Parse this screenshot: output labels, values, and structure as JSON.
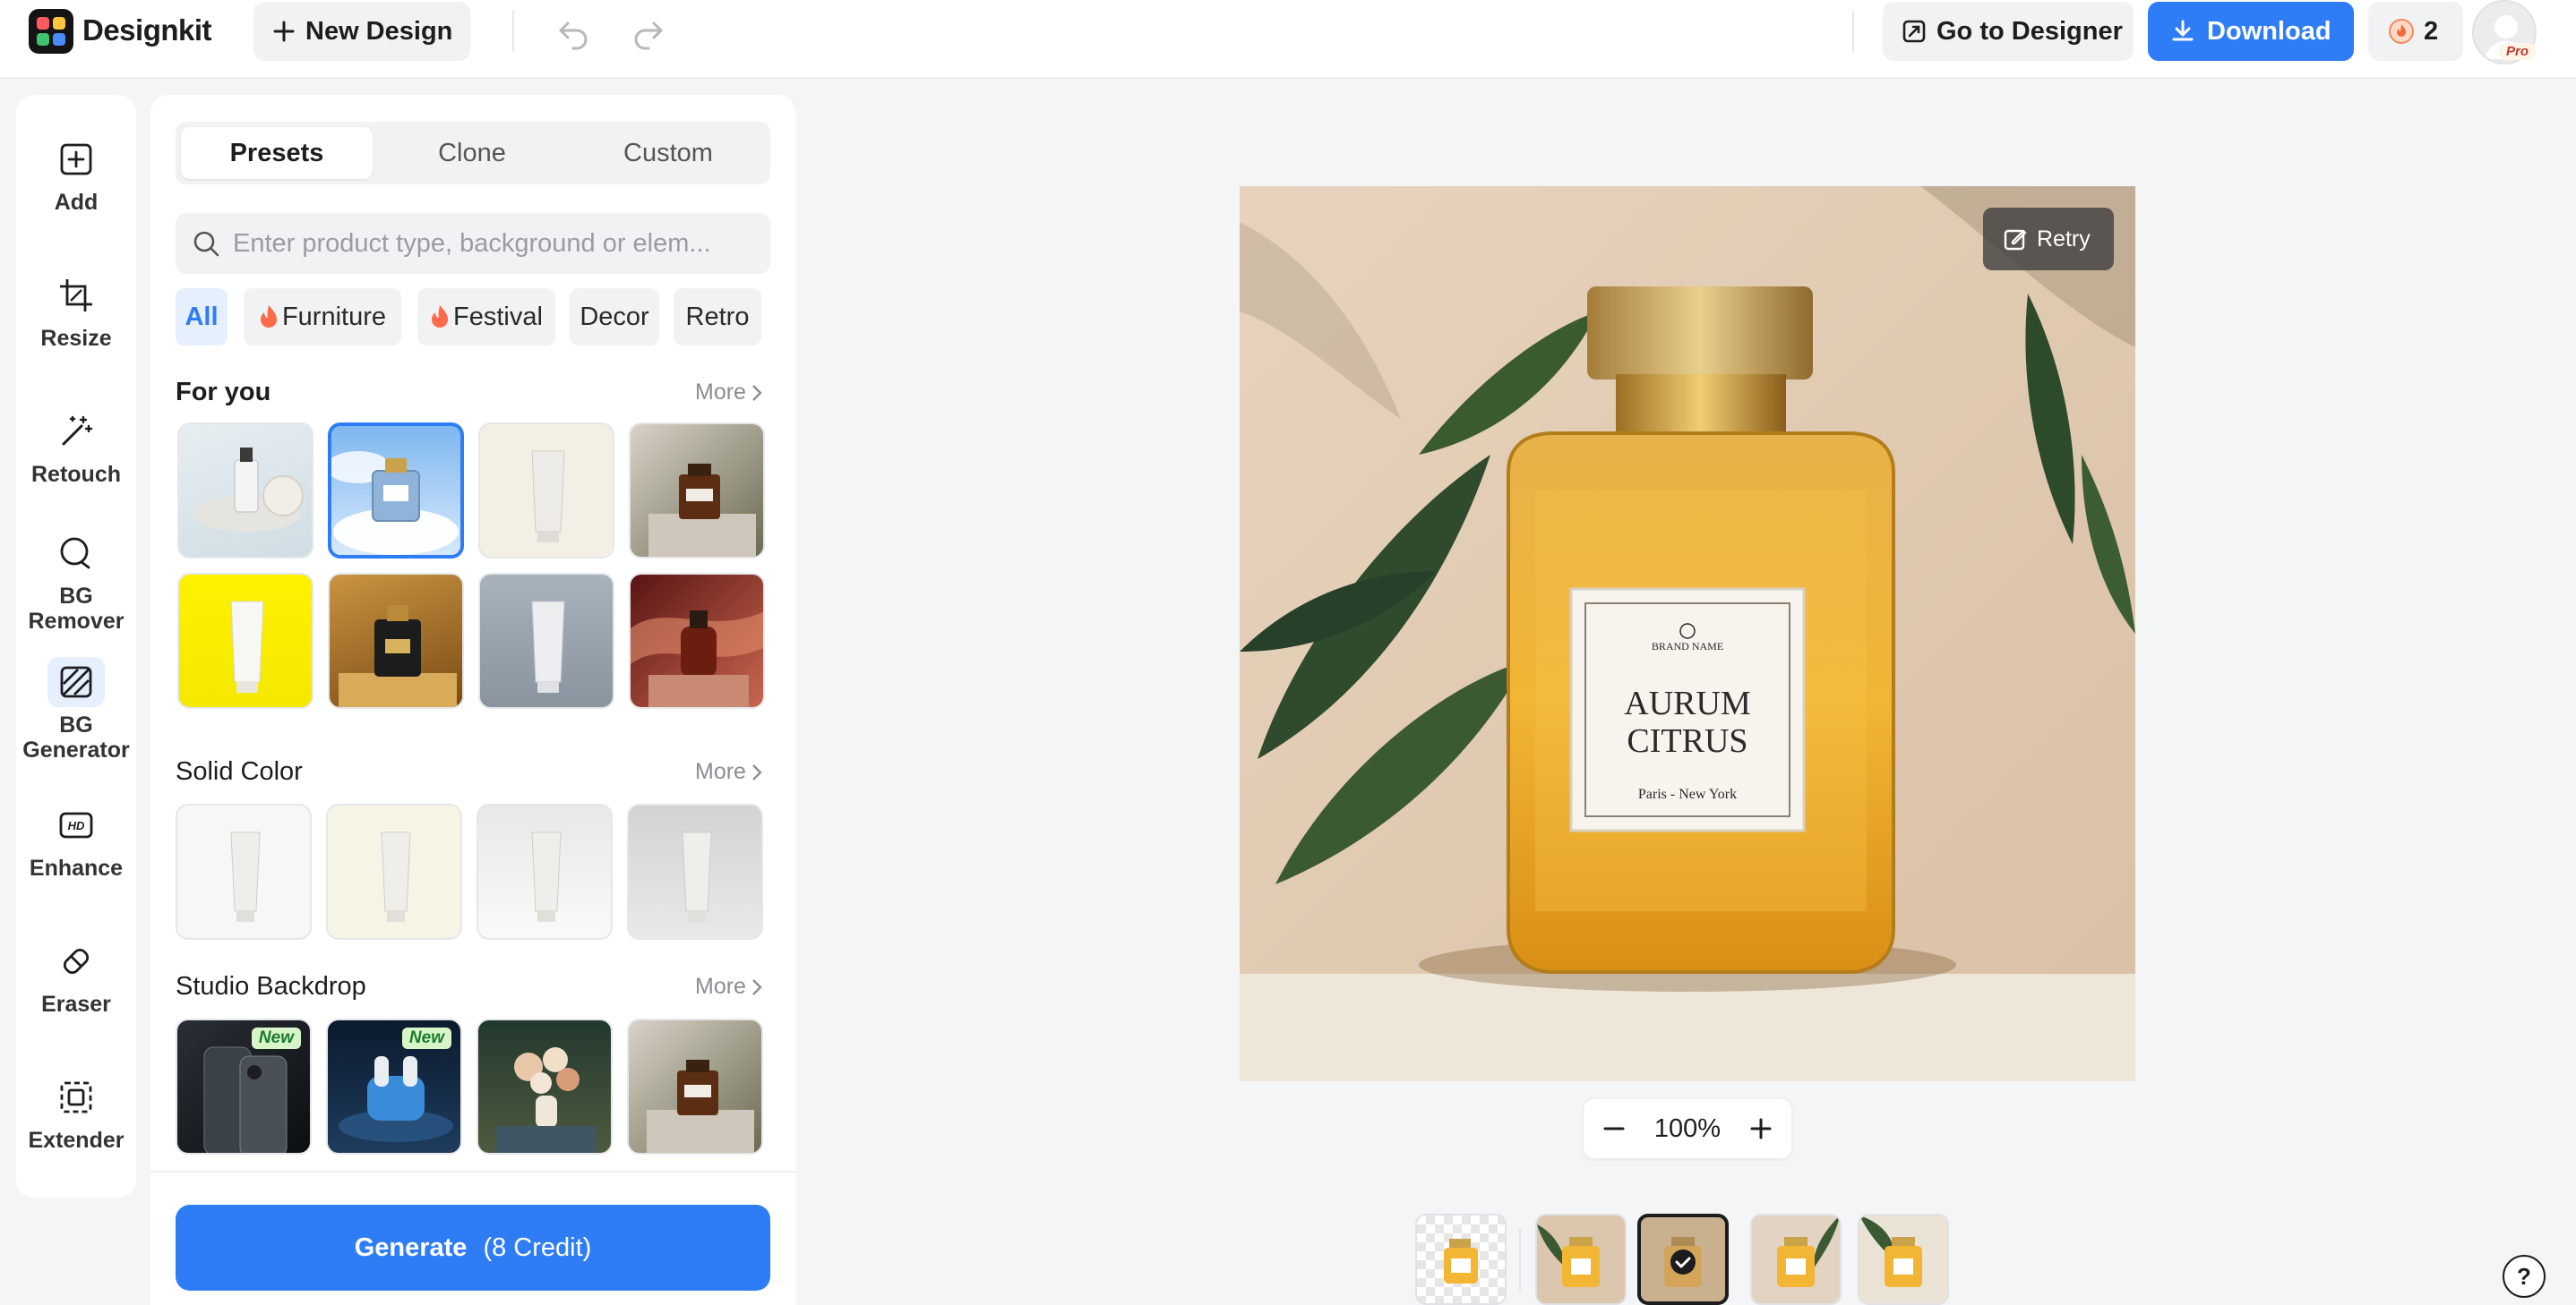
{
  "app": {
    "brand": "Designkit",
    "new_design": "New Design",
    "go_to_designer": "Go to Designer",
    "download": "Download",
    "credits": "2",
    "plan": "Pro"
  },
  "tools": [
    {
      "label": "Add",
      "icon": "add-icon"
    },
    {
      "label": "Resize",
      "icon": "crop-icon"
    },
    {
      "label": "Retouch",
      "icon": "magic-wand-icon"
    },
    {
      "label": "BG Remover",
      "icon": "bg-remover-icon"
    },
    {
      "label": "BG Generator",
      "icon": "bg-generator-icon",
      "active": true
    },
    {
      "label": "Enhance",
      "icon": "hd-icon"
    },
    {
      "label": "Eraser",
      "icon": "eraser-icon"
    },
    {
      "label": "Extender",
      "icon": "extender-icon"
    }
  ],
  "tabs": [
    "Presets",
    "Clone",
    "Custom"
  ],
  "search": {
    "placeholder": "Enter product type, background or elem..."
  },
  "chips": [
    "All",
    "Furniture",
    "Festival",
    "Decor",
    "Retro"
  ],
  "sections": {
    "for_you": {
      "title": "For you",
      "more": "More"
    },
    "solid_color": {
      "title": "Solid Color",
      "more": "More"
    },
    "studio_backdrop": {
      "title": "Studio Backdrop",
      "more": "More",
      "badge": "New"
    }
  },
  "generate": {
    "label": "Generate",
    "credit": "(8 Credit)"
  },
  "canvas": {
    "retry": "Retry",
    "zoom": "100%",
    "label_brand": "BRAND NAME",
    "label_title_1": "AURUM",
    "label_title_2": "CITRUS",
    "label_sub": "Paris - New York"
  },
  "colors": {
    "accent": "#2f7df6",
    "selected_border": "#2f7df6",
    "new_badge": "#d8f5c9"
  }
}
